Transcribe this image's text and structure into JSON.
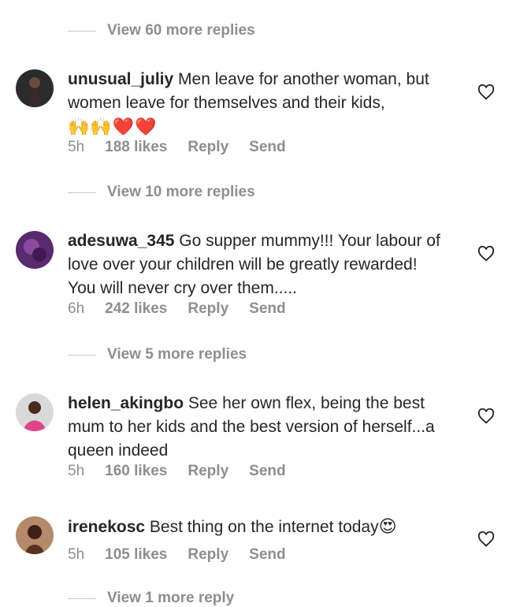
{
  "colors": {
    "meta": "#8e8e8e",
    "text": "#262626",
    "heart_red": "#ed2a2a"
  },
  "threads": [
    {
      "replies_label": "View 60 more replies"
    },
    {
      "replies_label": "View 10 more replies"
    },
    {
      "replies_label": "View 5 more replies"
    },
    {
      "replies_label": "View 1 more reply"
    }
  ],
  "comments": [
    {
      "username": "unusual_juliy",
      "text": "Men leave for another woman, but women leave for themselves and their kids,",
      "emoji": "🙌🙌❤️❤️",
      "time": "5h",
      "likes": "188 likes",
      "reply": "Reply",
      "send": "Send",
      "avatar_icon": "profile-photo"
    },
    {
      "username": "adesuwa_345",
      "text": "Go supper mummy!!! Your labour of love over your children will be greatly rewarded! You will never cry over them.....",
      "time": "6h",
      "likes": "242 likes",
      "reply": "Reply",
      "send": "Send",
      "avatar_icon": "profile-photo"
    },
    {
      "username": "helen_akingbo",
      "text": "See her own flex, being the best mum to her kids and the best version of herself...a queen indeed",
      "time": "5h",
      "likes": "160 likes",
      "reply": "Reply",
      "send": "Send",
      "avatar_icon": "profile-photo"
    },
    {
      "username": "irenekosc",
      "text": "Best thing on the internet today",
      "emoji": "😍",
      "time": "5h",
      "likes": "105 likes",
      "reply": "Reply",
      "send": "Send",
      "avatar_icon": "profile-photo"
    }
  ]
}
